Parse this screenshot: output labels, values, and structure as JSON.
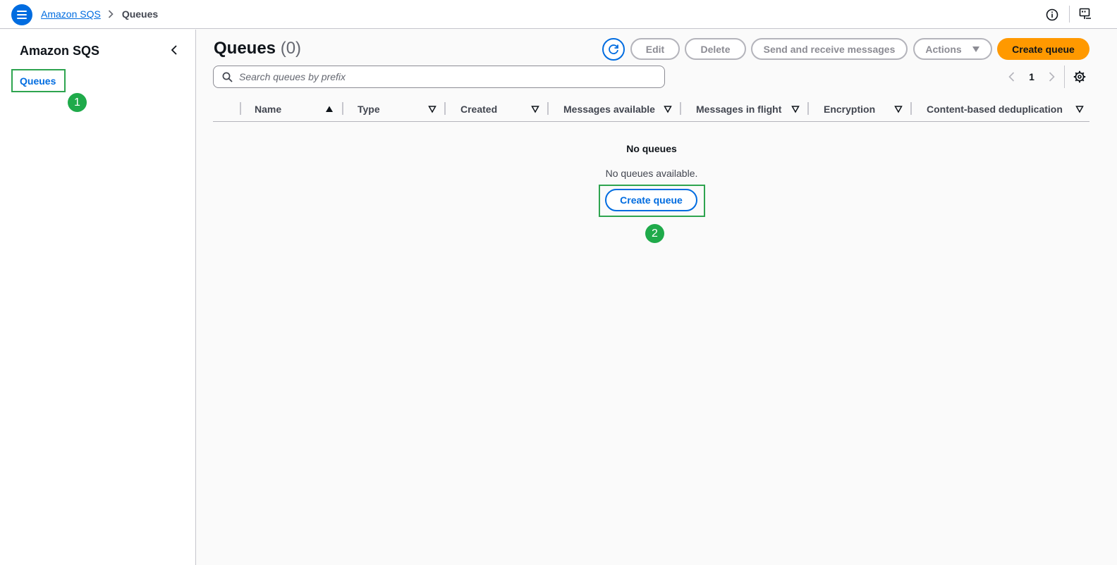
{
  "header": {
    "breadcrumb": {
      "service": "Amazon SQS",
      "current": "Queues"
    },
    "icons": [
      "menu-icon",
      "info-icon",
      "feedback-icon"
    ]
  },
  "sidebar": {
    "title": "Amazon SQS",
    "items": [
      {
        "label": "Queues",
        "active": true
      }
    ]
  },
  "markers": {
    "one": "1",
    "two": "2"
  },
  "main": {
    "title": "Queues",
    "count": "(0)",
    "buttons": {
      "edit": "Edit",
      "delete": "Delete",
      "send_receive": "Send and receive messages",
      "actions": "Actions",
      "create": "Create queue"
    },
    "search": {
      "placeholder": "Search queues by prefix",
      "value": ""
    },
    "pagination": {
      "current_page": "1"
    },
    "table": {
      "columns": [
        "Name",
        "Type",
        "Created",
        "Messages available",
        "Messages in flight",
        "Encryption",
        "Content-based deduplication"
      ],
      "sorted_column": "Name"
    },
    "empty": {
      "title": "No queues",
      "description": "No queues available.",
      "button": "Create queue"
    }
  },
  "colors": {
    "primary_blue": "#006ce0",
    "primary_orange": "#ff9900",
    "highlight_green": "#2ea44f",
    "marker_green": "#1faa4a"
  }
}
